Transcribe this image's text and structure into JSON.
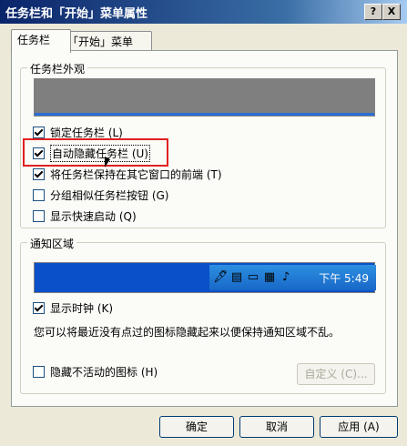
{
  "window": {
    "title": "任务栏和「开始」菜单属性",
    "help_btn": "?",
    "close_btn": "X"
  },
  "tabs": [
    {
      "label": "任务栏"
    },
    {
      "label": "「开始」菜单"
    }
  ],
  "appearance": {
    "title": "任务栏外观",
    "options": [
      {
        "label": "锁定任务栏 (L)",
        "checked": true
      },
      {
        "label": "自动隐藏任务栏 (U)",
        "checked": true
      },
      {
        "label": "将任务栏保持在其它窗口的前端 (T)",
        "checked": true
      },
      {
        "label": "分组相似任务栏按钮 (G)",
        "checked": false
      },
      {
        "label": "显示快速启动 (Q)",
        "checked": false
      }
    ]
  },
  "notification": {
    "title": "通知区域",
    "tray_time": "下午 5:49",
    "show_clock": {
      "label": "显示时钟 (K)",
      "checked": true
    },
    "description": "您可以将最近没有点过的图标隐藏起来以便保持通知区域不乱。",
    "hide_inactive": {
      "label": "隐藏不活动的图标 (H)",
      "checked": false
    },
    "customize_btn": "自定义 (C)..."
  },
  "buttons": {
    "ok": "确定",
    "cancel": "取消",
    "apply": "应用 (A)"
  },
  "colors": {
    "titlebar": "#0a246a",
    "highlight_box": "#e02020",
    "taskbar_blue": "#1868c8"
  }
}
